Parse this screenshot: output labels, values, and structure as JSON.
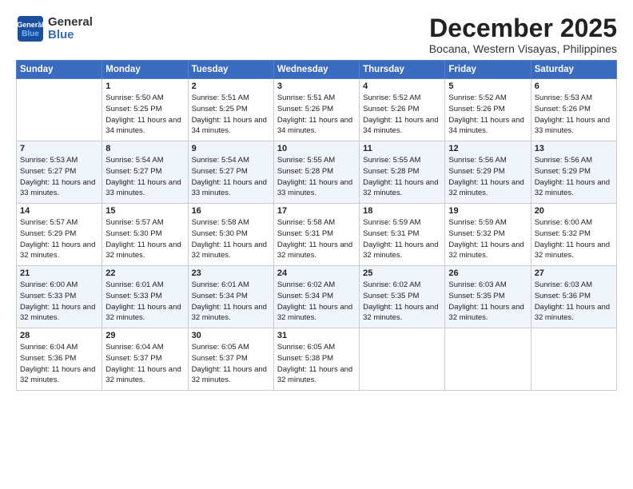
{
  "logo": {
    "text_line1": "General",
    "text_line2": "Blue"
  },
  "title": {
    "month_year": "December 2025",
    "location": "Bocana, Western Visayas, Philippines"
  },
  "header_days": [
    "Sunday",
    "Monday",
    "Tuesday",
    "Wednesday",
    "Thursday",
    "Friday",
    "Saturday"
  ],
  "weeks": [
    [
      {
        "day": "",
        "sunrise": "",
        "sunset": "",
        "daylight": ""
      },
      {
        "day": "1",
        "sunrise": "Sunrise: 5:50 AM",
        "sunset": "Sunset: 5:25 PM",
        "daylight": "Daylight: 11 hours and 34 minutes."
      },
      {
        "day": "2",
        "sunrise": "Sunrise: 5:51 AM",
        "sunset": "Sunset: 5:25 PM",
        "daylight": "Daylight: 11 hours and 34 minutes."
      },
      {
        "day": "3",
        "sunrise": "Sunrise: 5:51 AM",
        "sunset": "Sunset: 5:26 PM",
        "daylight": "Daylight: 11 hours and 34 minutes."
      },
      {
        "day": "4",
        "sunrise": "Sunrise: 5:52 AM",
        "sunset": "Sunset: 5:26 PM",
        "daylight": "Daylight: 11 hours and 34 minutes."
      },
      {
        "day": "5",
        "sunrise": "Sunrise: 5:52 AM",
        "sunset": "Sunset: 5:26 PM",
        "daylight": "Daylight: 11 hours and 34 minutes."
      },
      {
        "day": "6",
        "sunrise": "Sunrise: 5:53 AM",
        "sunset": "Sunset: 5:26 PM",
        "daylight": "Daylight: 11 hours and 33 minutes."
      }
    ],
    [
      {
        "day": "7",
        "sunrise": "Sunrise: 5:53 AM",
        "sunset": "Sunset: 5:27 PM",
        "daylight": "Daylight: 11 hours and 33 minutes."
      },
      {
        "day": "8",
        "sunrise": "Sunrise: 5:54 AM",
        "sunset": "Sunset: 5:27 PM",
        "daylight": "Daylight: 11 hours and 33 minutes."
      },
      {
        "day": "9",
        "sunrise": "Sunrise: 5:54 AM",
        "sunset": "Sunset: 5:27 PM",
        "daylight": "Daylight: 11 hours and 33 minutes."
      },
      {
        "day": "10",
        "sunrise": "Sunrise: 5:55 AM",
        "sunset": "Sunset: 5:28 PM",
        "daylight": "Daylight: 11 hours and 33 minutes."
      },
      {
        "day": "11",
        "sunrise": "Sunrise: 5:55 AM",
        "sunset": "Sunset: 5:28 PM",
        "daylight": "Daylight: 11 hours and 32 minutes."
      },
      {
        "day": "12",
        "sunrise": "Sunrise: 5:56 AM",
        "sunset": "Sunset: 5:29 PM",
        "daylight": "Daylight: 11 hours and 32 minutes."
      },
      {
        "day": "13",
        "sunrise": "Sunrise: 5:56 AM",
        "sunset": "Sunset: 5:29 PM",
        "daylight": "Daylight: 11 hours and 32 minutes."
      }
    ],
    [
      {
        "day": "14",
        "sunrise": "Sunrise: 5:57 AM",
        "sunset": "Sunset: 5:29 PM",
        "daylight": "Daylight: 11 hours and 32 minutes."
      },
      {
        "day": "15",
        "sunrise": "Sunrise: 5:57 AM",
        "sunset": "Sunset: 5:30 PM",
        "daylight": "Daylight: 11 hours and 32 minutes."
      },
      {
        "day": "16",
        "sunrise": "Sunrise: 5:58 AM",
        "sunset": "Sunset: 5:30 PM",
        "daylight": "Daylight: 11 hours and 32 minutes."
      },
      {
        "day": "17",
        "sunrise": "Sunrise: 5:58 AM",
        "sunset": "Sunset: 5:31 PM",
        "daylight": "Daylight: 11 hours and 32 minutes."
      },
      {
        "day": "18",
        "sunrise": "Sunrise: 5:59 AM",
        "sunset": "Sunset: 5:31 PM",
        "daylight": "Daylight: 11 hours and 32 minutes."
      },
      {
        "day": "19",
        "sunrise": "Sunrise: 5:59 AM",
        "sunset": "Sunset: 5:32 PM",
        "daylight": "Daylight: 11 hours and 32 minutes."
      },
      {
        "day": "20",
        "sunrise": "Sunrise: 6:00 AM",
        "sunset": "Sunset: 5:32 PM",
        "daylight": "Daylight: 11 hours and 32 minutes."
      }
    ],
    [
      {
        "day": "21",
        "sunrise": "Sunrise: 6:00 AM",
        "sunset": "Sunset: 5:33 PM",
        "daylight": "Daylight: 11 hours and 32 minutes."
      },
      {
        "day": "22",
        "sunrise": "Sunrise: 6:01 AM",
        "sunset": "Sunset: 5:33 PM",
        "daylight": "Daylight: 11 hours and 32 minutes."
      },
      {
        "day": "23",
        "sunrise": "Sunrise: 6:01 AM",
        "sunset": "Sunset: 5:34 PM",
        "daylight": "Daylight: 11 hours and 32 minutes."
      },
      {
        "day": "24",
        "sunrise": "Sunrise: 6:02 AM",
        "sunset": "Sunset: 5:34 PM",
        "daylight": "Daylight: 11 hours and 32 minutes."
      },
      {
        "day": "25",
        "sunrise": "Sunrise: 6:02 AM",
        "sunset": "Sunset: 5:35 PM",
        "daylight": "Daylight: 11 hours and 32 minutes."
      },
      {
        "day": "26",
        "sunrise": "Sunrise: 6:03 AM",
        "sunset": "Sunset: 5:35 PM",
        "daylight": "Daylight: 11 hours and 32 minutes."
      },
      {
        "day": "27",
        "sunrise": "Sunrise: 6:03 AM",
        "sunset": "Sunset: 5:36 PM",
        "daylight": "Daylight: 11 hours and 32 minutes."
      }
    ],
    [
      {
        "day": "28",
        "sunrise": "Sunrise: 6:04 AM",
        "sunset": "Sunset: 5:36 PM",
        "daylight": "Daylight: 11 hours and 32 minutes."
      },
      {
        "day": "29",
        "sunrise": "Sunrise: 6:04 AM",
        "sunset": "Sunset: 5:37 PM",
        "daylight": "Daylight: 11 hours and 32 minutes."
      },
      {
        "day": "30",
        "sunrise": "Sunrise: 6:05 AM",
        "sunset": "Sunset: 5:37 PM",
        "daylight": "Daylight: 11 hours and 32 minutes."
      },
      {
        "day": "31",
        "sunrise": "Sunrise: 6:05 AM",
        "sunset": "Sunset: 5:38 PM",
        "daylight": "Daylight: 11 hours and 32 minutes."
      },
      {
        "day": "",
        "sunrise": "",
        "sunset": "",
        "daylight": ""
      },
      {
        "day": "",
        "sunrise": "",
        "sunset": "",
        "daylight": ""
      },
      {
        "day": "",
        "sunrise": "",
        "sunset": "",
        "daylight": ""
      }
    ]
  ]
}
